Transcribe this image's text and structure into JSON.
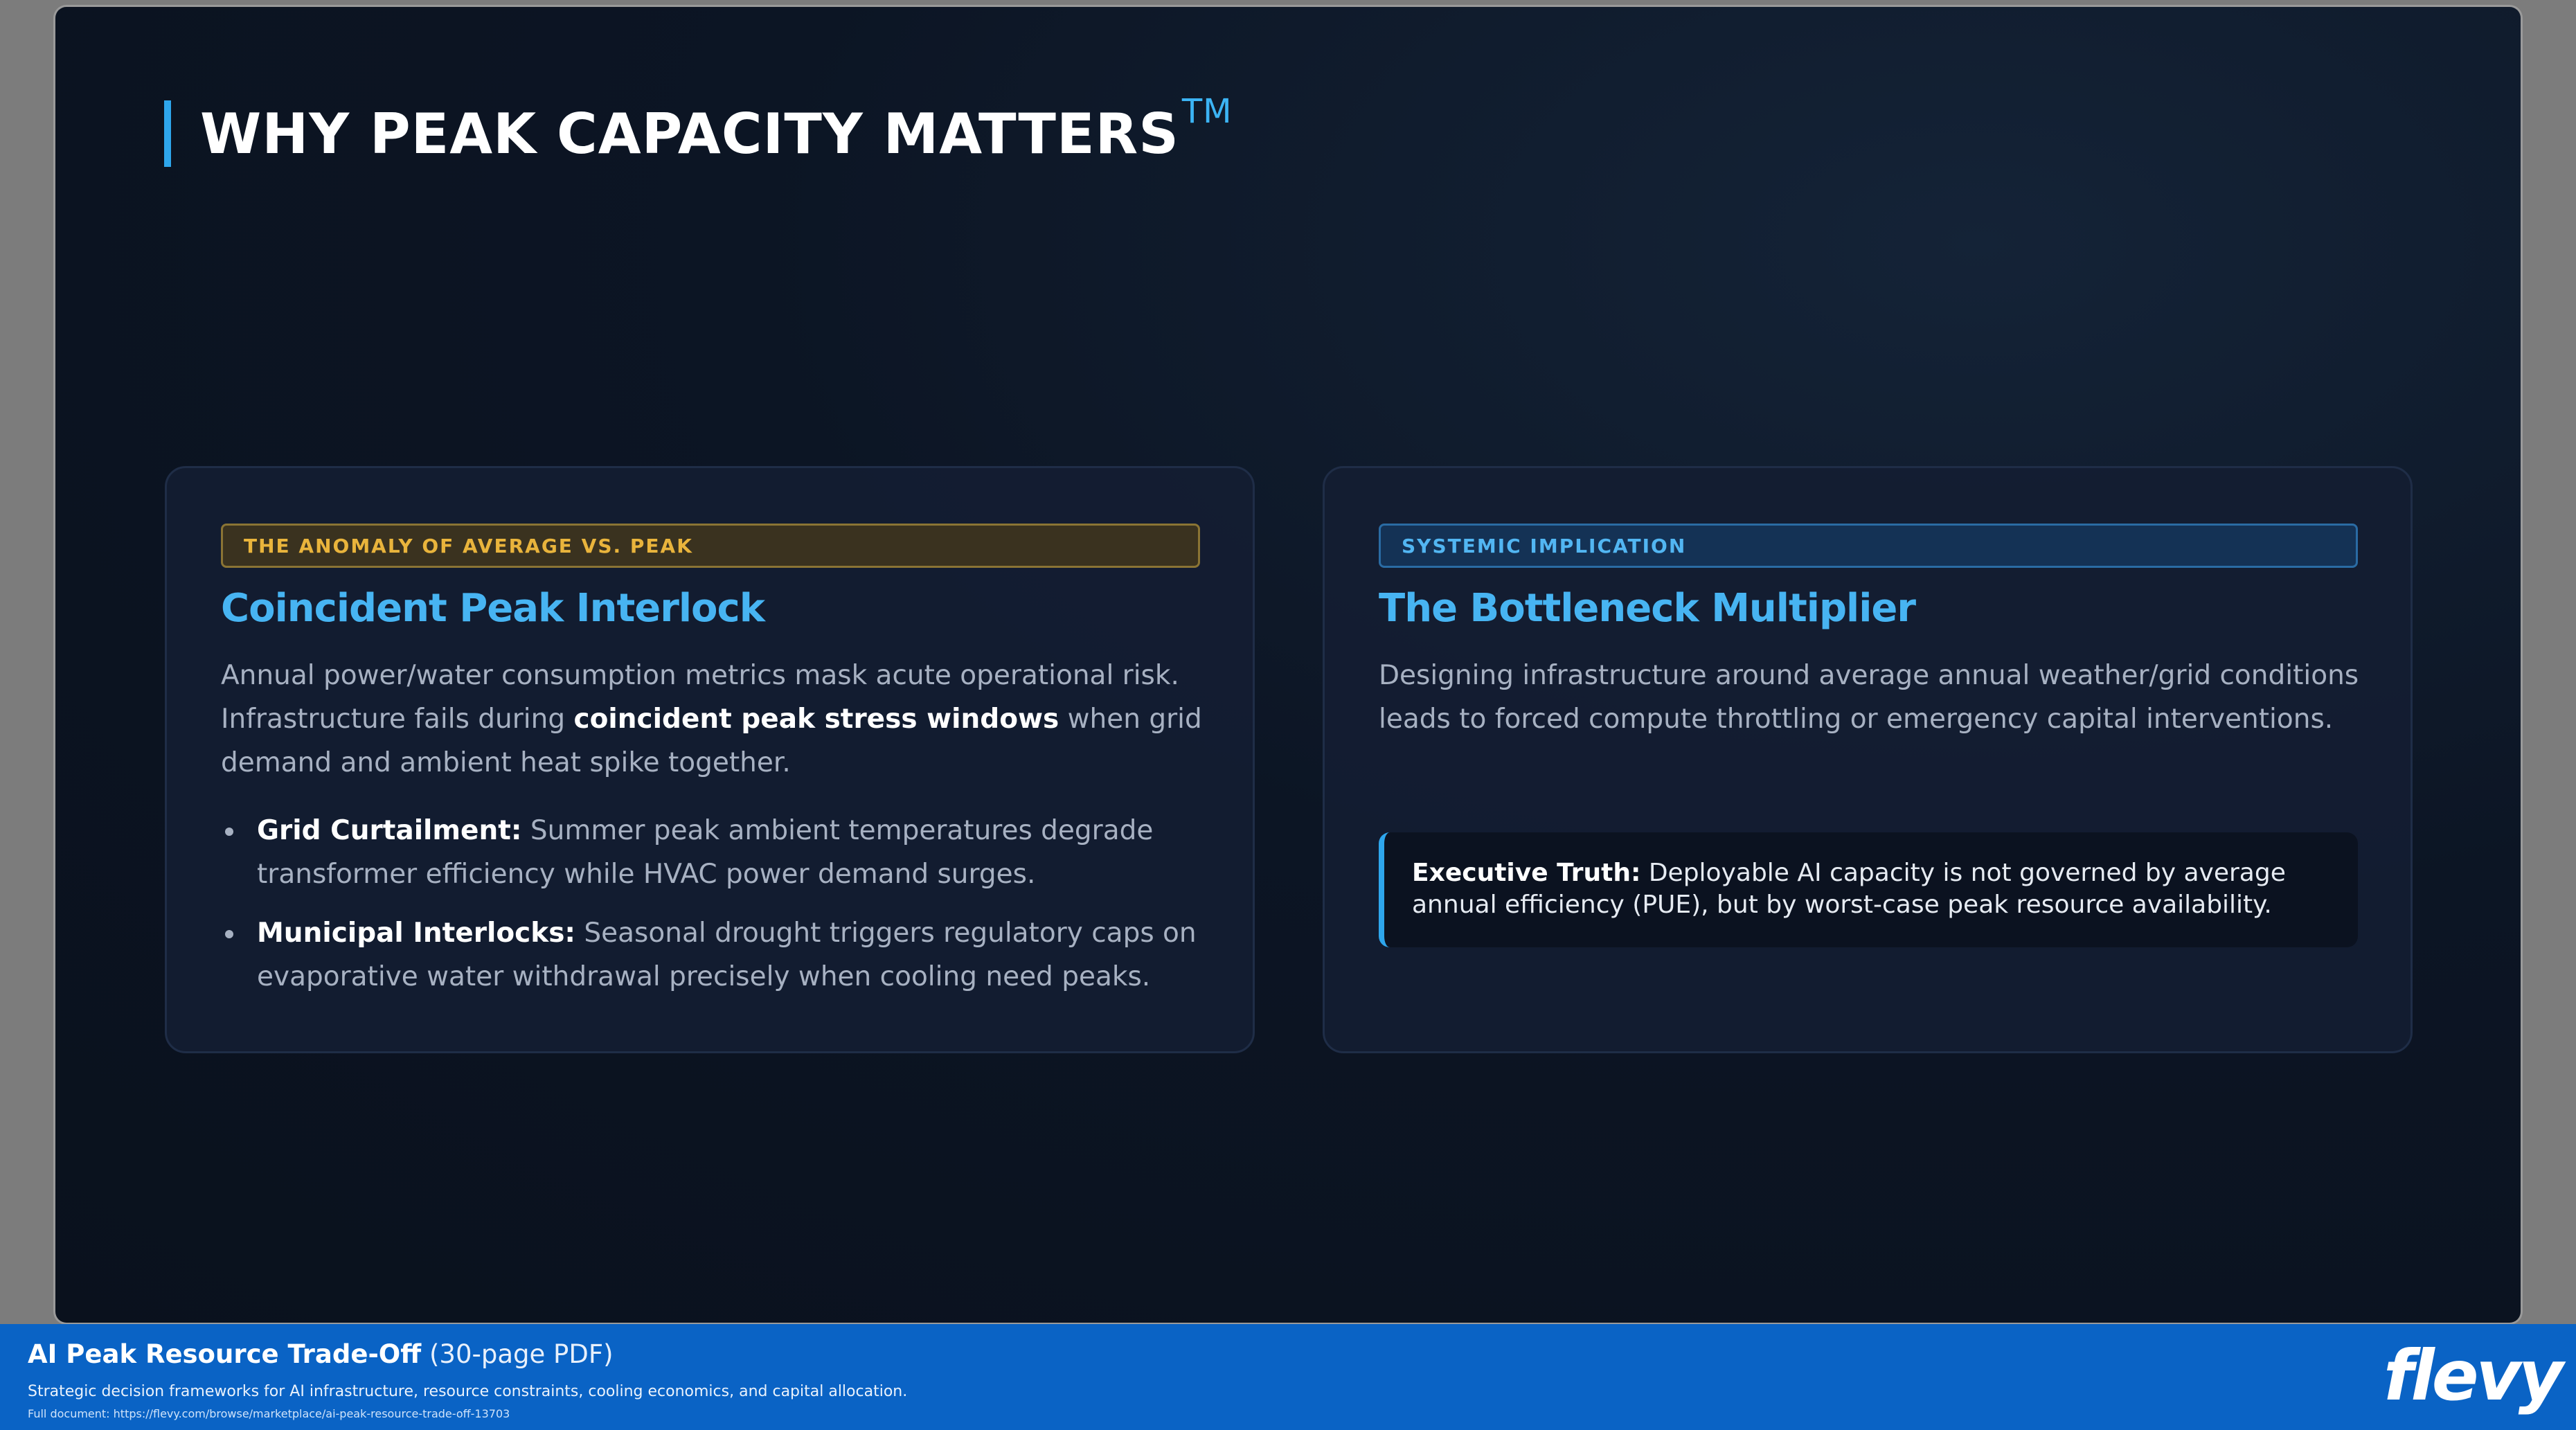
{
  "slide": {
    "title": "WHY PEAK CAPACITY MATTERS",
    "title_mark": "TM"
  },
  "left_card": {
    "tag": "THE ANOMALY OF AVERAGE VS. PEAK",
    "heading": "Coincident Peak Interlock",
    "intro_1": "Annual power/water consumption metrics mask acute operational risk. Infrastructure fails during ",
    "intro_bold": "coincident peak stress windows",
    "intro_2": " when grid demand and ambient heat spike together.",
    "bullets": [
      {
        "label": "Grid Curtailment:",
        "text": " Summer peak ambient temperatures degrade transformer efficiency while HVAC power demand surges."
      },
      {
        "label": "Municipal Interlocks:",
        "text": " Seasonal drought triggers regulatory caps on evaporative water withdrawal precisely when cooling need peaks."
      }
    ]
  },
  "right_card": {
    "tag": "SYSTEMIC IMPLICATION",
    "heading": "The Bottleneck Multiplier",
    "paragraph": "Designing infrastructure around average annual weather/grid conditions leads to forced compute throttling or emergency capital interventions.",
    "callout_label": "Executive Truth:",
    "callout_text": " Deployable AI capacity is not governed by average annual efficiency (PUE), but by worst-case peak resource availability."
  },
  "footer": {
    "title": "AI Peak Resource Trade-Off",
    "title_suffix": " (30-page PDF)",
    "description": "Strategic decision frameworks for AI infrastructure, resource constraints, cooling economics, and capital allocation.",
    "link": "Full document: https://flevy.com/browse/marketplace/ai-peak-resource-trade-off-13703",
    "logo": "flevy"
  },
  "colors": {
    "accent": "#2ea6ec",
    "heading": "#47b4f2",
    "amber_tag": "#e9b43c",
    "footer_bg": "#0a63c5"
  }
}
